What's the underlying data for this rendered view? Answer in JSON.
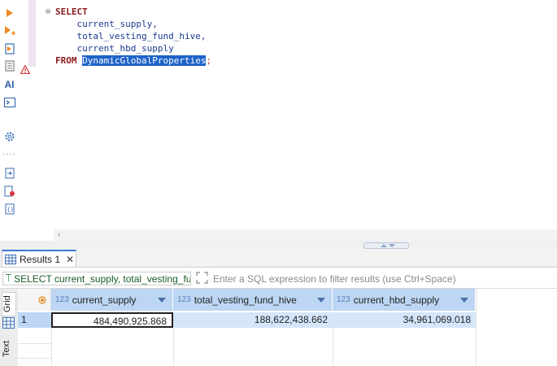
{
  "editor": {
    "lines": [
      {
        "kw": "SELECT",
        "text": ""
      },
      {
        "kw": "",
        "text": "    current_supply,"
      },
      {
        "kw": "",
        "text": "    total_vesting_fund_hive,"
      },
      {
        "kw": "",
        "text": "    current_hbd_supply"
      },
      {
        "kw": "FROM",
        "selected": "DynamicGlobalProperties",
        "tail": ";"
      }
    ],
    "fold_marker": "⊖"
  },
  "results": {
    "tab_label": "Results 1",
    "filter_query": "SELECT current_supply, total_vesting_fu",
    "filter_placeholder": "Enter a SQL expression to filter results (use Ctrl+Space)",
    "side_tabs": [
      "Grid",
      "Text"
    ],
    "columns": [
      {
        "type": "123",
        "name": "current_supply"
      },
      {
        "type": "123",
        "name": "total_vesting_fund_hive"
      },
      {
        "type": "123",
        "name": "current_hbd_supply"
      }
    ],
    "rows": [
      {
        "num": "1",
        "values": [
          "484,490,925.868",
          "188,622,438.662",
          "34,961,069.018"
        ]
      }
    ]
  },
  "icons": [
    "run-icon",
    "run-script-icon",
    "explain-icon",
    "history-icon",
    "warning-icon",
    "ai-icon",
    "terminal-icon",
    "settings-icon",
    "export-icon",
    "error-file-icon",
    "json-icon",
    "scroll-left-icon",
    "close-icon",
    "filter-icon",
    "expand-icon",
    "grid-icon"
  ],
  "colors": {
    "keyword": "#8b1a1a",
    "selection": "#1e63c9",
    "header": "#bcd6f3",
    "selected_row": "#d5e6fa"
  }
}
